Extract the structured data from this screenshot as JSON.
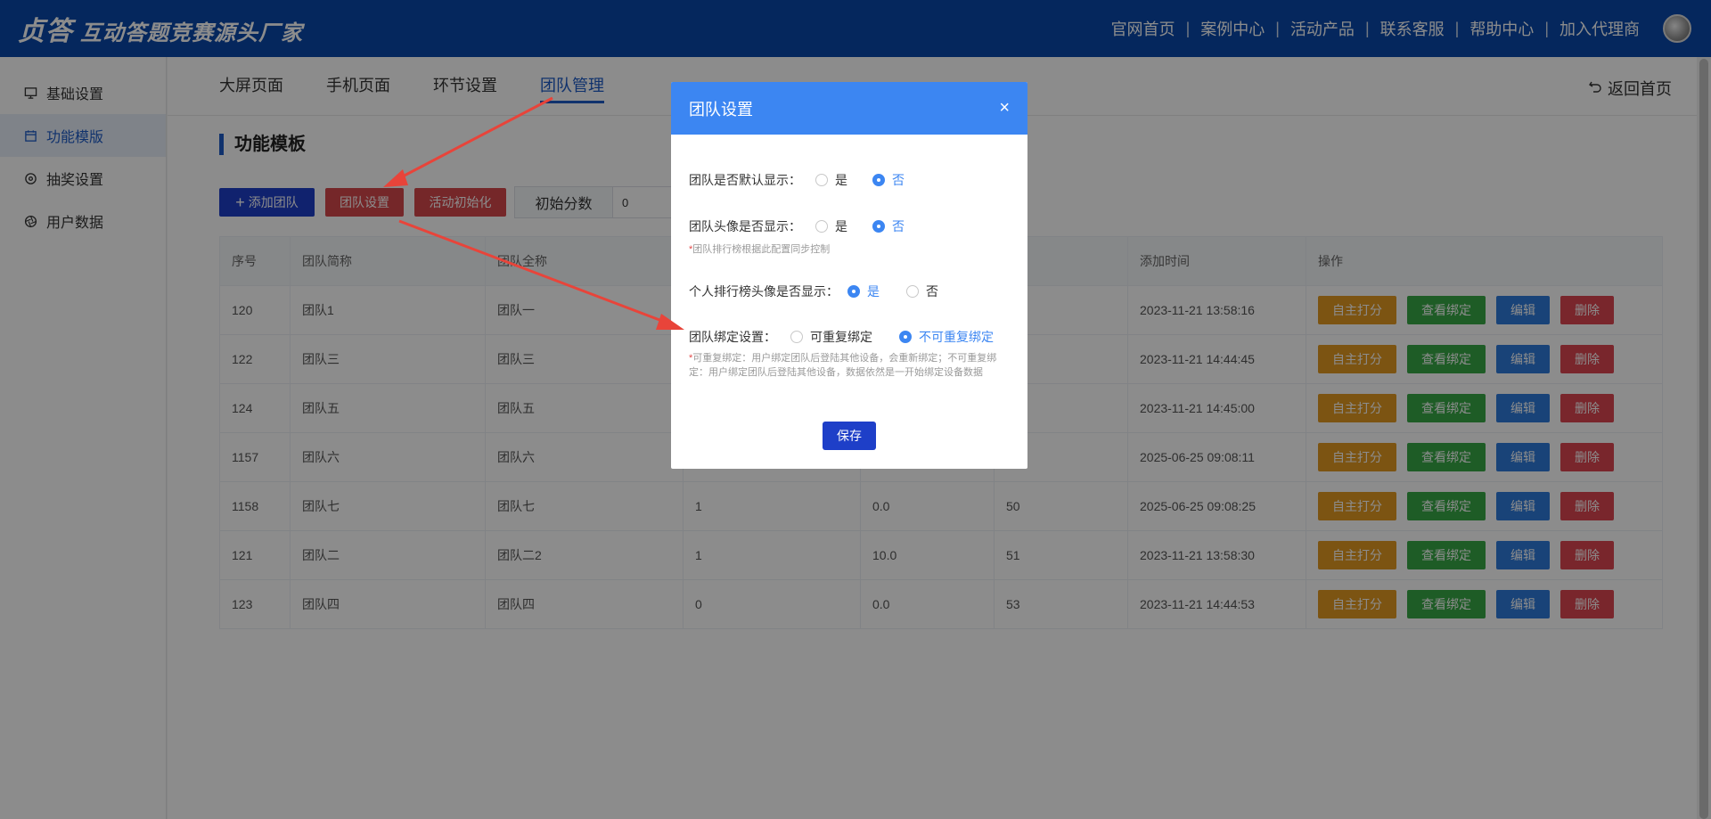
{
  "header": {
    "brand": "贞答",
    "slogan": "互动答题竞赛源头厂家",
    "nav": [
      "官网首页",
      "案例中心",
      "活动产品",
      "联系客服",
      "帮助中心",
      "加入代理商"
    ]
  },
  "sidebar": {
    "items": [
      {
        "label": "基础设置",
        "icon": "monitor-icon"
      },
      {
        "label": "功能模版",
        "icon": "calendar-icon"
      },
      {
        "label": "抽奖设置",
        "icon": "gear-icon"
      },
      {
        "label": "用户数据",
        "icon": "aperture-icon"
      }
    ],
    "active_index": 1
  },
  "tabs": [
    "大屏页面",
    "手机页面",
    "环节设置",
    "团队管理"
  ],
  "active_tab": 3,
  "back_label": "返回首页",
  "section_title": "功能模板",
  "toolbar": {
    "add_label": "添加团队",
    "team_settings_label": "团队设置",
    "init_label": "活动初始化",
    "init_score_label": "初始分数",
    "init_score_value": "0"
  },
  "table": {
    "headers": [
      "序号",
      "团队简称",
      "团队全称",
      "",
      "",
      "",
      "添加时间",
      "操作"
    ],
    "rows": [
      {
        "id": "120",
        "short": "团队1",
        "full": "团队一",
        "c4": "",
        "c5": "",
        "c6": "",
        "time": "2023-11-21 13:58:16"
      },
      {
        "id": "122",
        "short": "团队三",
        "full": "团队三",
        "c4": "",
        "c5": "",
        "c6": "",
        "time": "2023-11-21 14:44:45"
      },
      {
        "id": "124",
        "short": "团队五",
        "full": "团队五",
        "c4": "",
        "c5": "",
        "c6": "",
        "time": "2023-11-21 14:45:00"
      },
      {
        "id": "1157",
        "short": "团队六",
        "full": "团队六",
        "c4": "",
        "c5": "",
        "c6": "",
        "time": "2025-06-25 09:08:11"
      },
      {
        "id": "1158",
        "short": "团队七",
        "full": "团队七",
        "c4": "1",
        "c5": "0.0",
        "c6": "50",
        "time": "2025-06-25 09:08:25"
      },
      {
        "id": "121",
        "short": "团队二",
        "full": "团队二2",
        "c4": "1",
        "c5": "10.0",
        "c6": "51",
        "time": "2023-11-21 13:58:30"
      },
      {
        "id": "123",
        "short": "团队四",
        "full": "团队四",
        "c4": "0",
        "c5": "0.0",
        "c6": "53",
        "time": "2023-11-21 14:44:53"
      }
    ],
    "actions": [
      "自主打分",
      "查看绑定",
      "编辑",
      "删除"
    ]
  },
  "modal": {
    "title": "团队设置",
    "rows": [
      {
        "label": "团队是否默认显示：",
        "options": [
          "是",
          "否"
        ],
        "selected": 1
      },
      {
        "label": "团队头像是否显示：",
        "options": [
          "是",
          "否"
        ],
        "selected": 1
      },
      {
        "label": "个人排行榜头像是否显示：",
        "options": [
          "是",
          "否"
        ],
        "selected": 0
      },
      {
        "label": "团队绑定设置：",
        "options": [
          "可重复绑定",
          "不可重复绑定"
        ],
        "selected": 1
      }
    ],
    "note_avatar": "团队排行榜根据此配置同步控制",
    "note_bind": "可重复绑定：用户绑定团队后登陆其他设备，会重新绑定；不可重复绑定：用户绑定团队后登陆其他设备，数据依然是一开始绑定设备数据",
    "save_label": "保存"
  },
  "colors": {
    "header": "#0a47a9",
    "primary": "#1e3fc8",
    "danger": "#d6484c",
    "modal_header": "#3c86f2",
    "annotation_arrow": "#e8443a"
  }
}
